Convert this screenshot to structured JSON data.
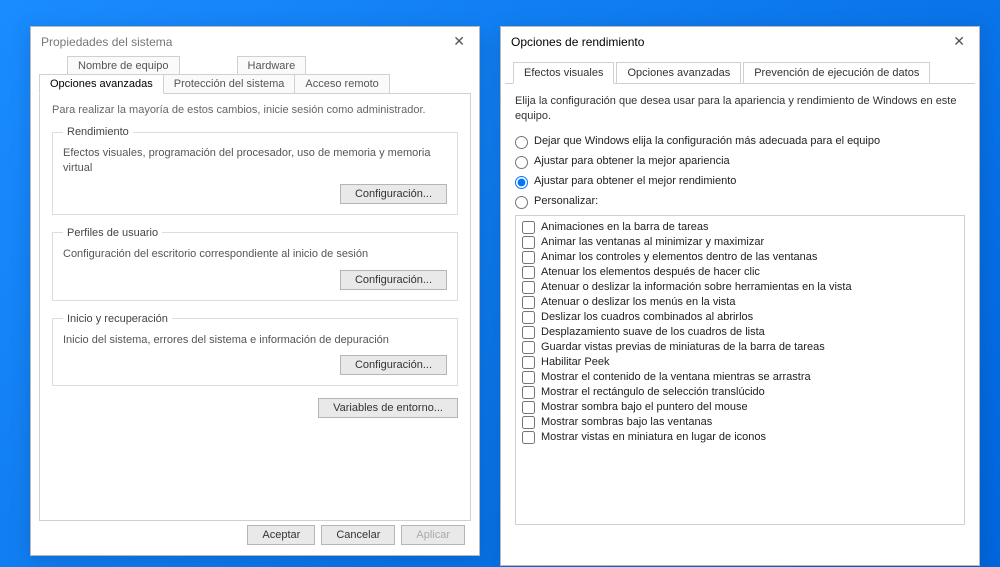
{
  "dlg1": {
    "title": "Propiedades del sistema",
    "tabs_top": [
      "Nombre de equipo",
      "Hardware"
    ],
    "tabs_bottom": [
      "Opciones avanzadas",
      "Protección del sistema",
      "Acceso remoto"
    ],
    "active_tab": "Opciones avanzadas",
    "note": "Para realizar la mayoría de estos cambios, inicie sesión como administrador.",
    "groups": {
      "rendimiento": {
        "legend": "Rendimiento",
        "desc": "Efectos visuales, programación del procesador, uso de memoria y memoria virtual",
        "btn": "Configuración..."
      },
      "perfiles": {
        "legend": "Perfiles de usuario",
        "desc": "Configuración del escritorio correspondiente al inicio de sesión",
        "btn": "Configuración..."
      },
      "inicio": {
        "legend": "Inicio y recuperación",
        "desc": "Inicio del sistema, errores del sistema e información de depuración",
        "btn": "Configuración..."
      }
    },
    "env_btn": "Variables de entorno...",
    "ok": "Aceptar",
    "cancel": "Cancelar",
    "apply": "Aplicar"
  },
  "dlg2": {
    "title": "Opciones de rendimiento",
    "tabs": [
      "Efectos visuales",
      "Opciones avanzadas",
      "Prevención de ejecución de datos"
    ],
    "active_tab": "Efectos visuales",
    "intro": "Elija la configuración que desea usar para la apariencia y rendimiento de Windows en este equipo.",
    "radios": [
      "Dejar que Windows elija la configuración más adecuada para el equipo",
      "Ajustar para obtener la mejor apariencia",
      "Ajustar para obtener el mejor rendimiento",
      "Personalizar:"
    ],
    "selected_radio": 2,
    "checks": [
      "Animaciones en la barra de tareas",
      "Animar las ventanas al minimizar y maximizar",
      "Animar los controles y elementos dentro de las ventanas",
      "Atenuar los elementos después de hacer clic",
      "Atenuar o deslizar la información sobre herramientas en la vista",
      "Atenuar o deslizar los menús en la vista",
      "Deslizar los cuadros combinados al abrirlos",
      "Desplazamiento suave de los cuadros de lista",
      "Guardar vistas previas de miniaturas de la barra de tareas",
      "Habilitar Peek",
      "Mostrar el contenido de la ventana mientras se arrastra",
      "Mostrar el rectángulo de selección translúcido",
      "Mostrar sombra bajo el puntero del mouse",
      "Mostrar sombras bajo las ventanas",
      "Mostrar vistas en miniatura en lugar de iconos"
    ]
  }
}
